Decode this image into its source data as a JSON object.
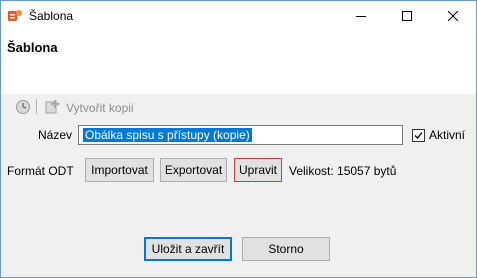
{
  "window": {
    "title": "Šablona",
    "controls": {
      "minimize": "minimize-icon",
      "maximize": "maximize-icon",
      "close": "close-icon"
    }
  },
  "header": {
    "title": "Šablona"
  },
  "toolbar": {
    "history_icon": "history-icon",
    "create_copy_icon": "add-copy-icon",
    "create_copy_label": "Vytvořit kopii"
  },
  "form": {
    "name_label": "Název",
    "name_value": "Obálka spisu s přístupy (kopie)",
    "active_label": "Aktivní",
    "active_checked": true,
    "format_label": "Formát ODT",
    "import_label": "Importovat",
    "export_label": "Exportovat",
    "edit_label": "Upravit",
    "size_text": "Velikost: 15057 bytů"
  },
  "footer": {
    "save_close_label": "Uložit a zavřít",
    "cancel_label": "Storno"
  },
  "colors": {
    "selection": "#0078d7",
    "active_button_border": "#c83f3f",
    "app_icon": "#e05a2b"
  }
}
